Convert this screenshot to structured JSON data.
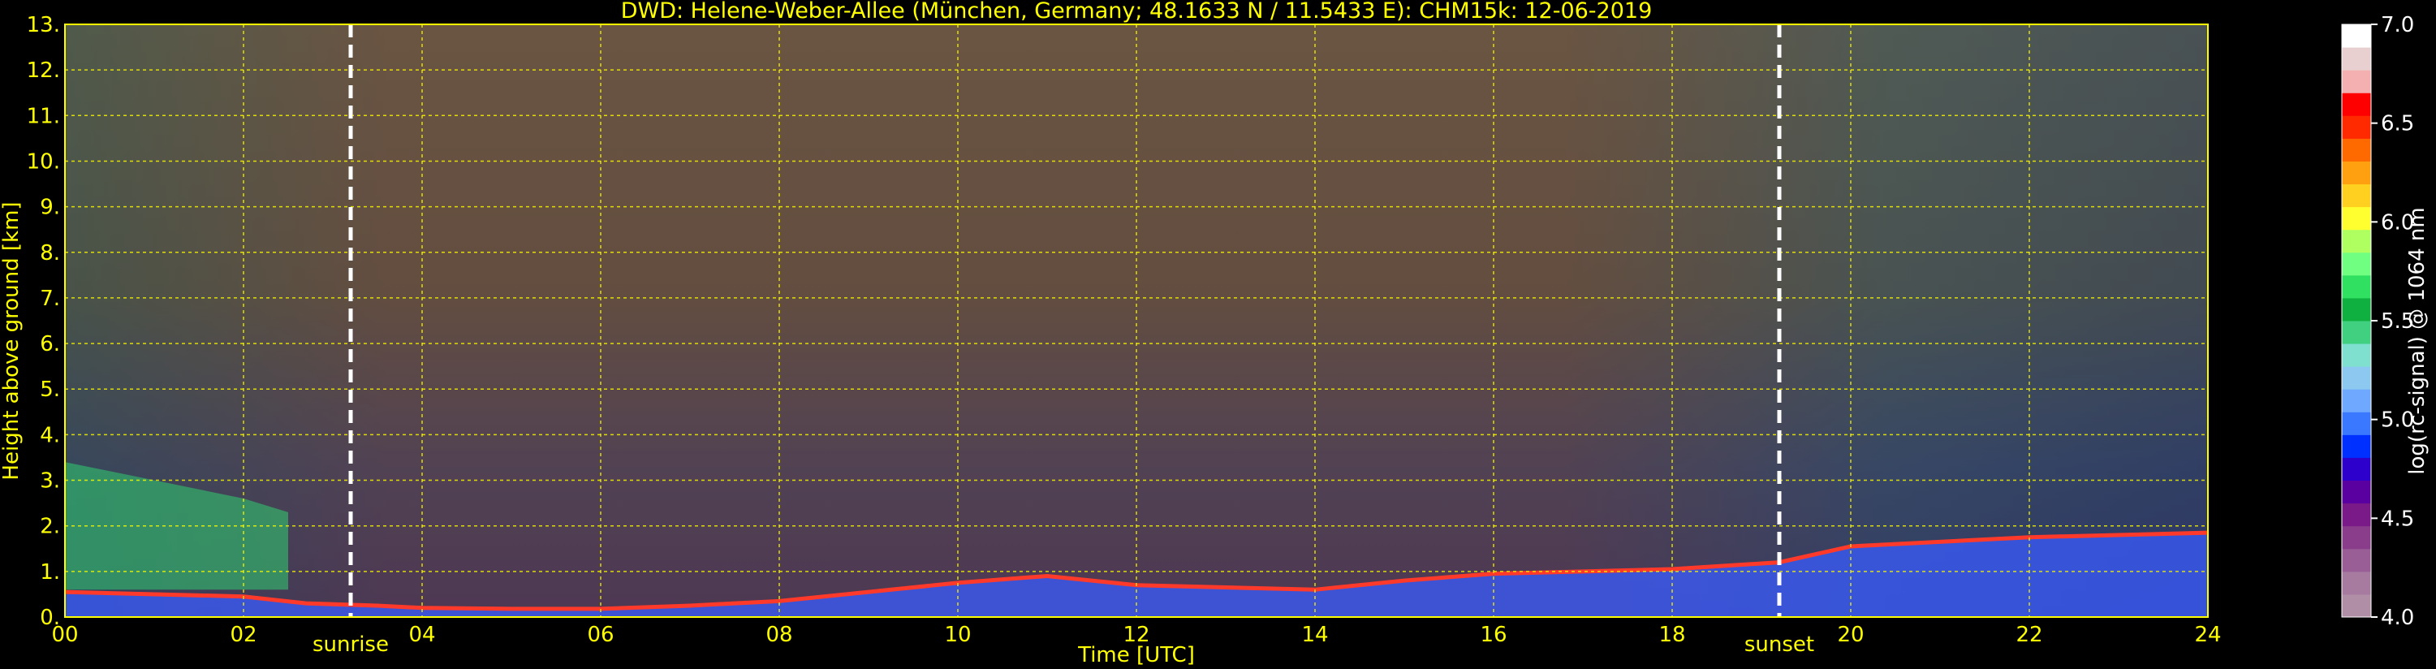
{
  "chart_data": {
    "type": "heatmap",
    "title": "DWD: Helene-Weber-Allee (München, Germany; 48.1633 N / 11.5433 E):    CHM15k: 12-06-2019",
    "xlabel": "Time [UTC]",
    "ylabel": "Height above ground [km]",
    "xlim": [
      0,
      24
    ],
    "ylim": [
      0,
      13
    ],
    "x_ticks": [
      "00",
      "02",
      "04",
      "06",
      "08",
      "10",
      "12",
      "14",
      "16",
      "18",
      "20",
      "22",
      "24"
    ],
    "x_tick_values": [
      0,
      2,
      4,
      6,
      8,
      10,
      12,
      14,
      16,
      18,
      20,
      22,
      24
    ],
    "y_ticks": [
      "0.",
      "1.",
      "2.",
      "3.",
      "4.",
      "5.",
      "6.",
      "7.",
      "8.",
      "9.",
      "10.",
      "11.",
      "12.",
      "13."
    ],
    "y_tick_values": [
      0,
      1,
      2,
      3,
      4,
      5,
      6,
      7,
      8,
      9,
      10,
      11,
      12,
      13
    ],
    "grid": true,
    "grid_color": "#ffff00",
    "events": [
      {
        "label": "sunrise",
        "time": 3.2
      },
      {
        "label": "sunset",
        "time": 19.2
      }
    ],
    "colorbar": {
      "label": "log(rc-signal) @ 1064 nm",
      "range": [
        4.0,
        7.0
      ],
      "ticks": [
        "4.0",
        "4.5",
        "5.0",
        "5.5",
        "6.0",
        "6.5",
        "7.0"
      ],
      "tick_values": [
        4.0,
        4.5,
        5.0,
        5.5,
        6.0,
        6.5,
        7.0
      ],
      "colors": [
        "#b08ea6",
        "#a77aa0",
        "#9a5e96",
        "#8a3d8a",
        "#7a1a88",
        "#5a00a0",
        "#2d00cc",
        "#0030ff",
        "#3a78ff",
        "#6fa8ff",
        "#8cc8f0",
        "#7fe0d0",
        "#40d080",
        "#10b040",
        "#30e060",
        "#70ff80",
        "#b0ff60",
        "#ffff30",
        "#ffd020",
        "#ffa010",
        "#ff6a00",
        "#ff2a00",
        "#ff0000",
        "#f4b0b0",
        "#e8d0d0",
        "#ffffff"
      ]
    },
    "features": [
      {
        "name": "boundary layer top",
        "t": [
          0,
          2,
          2.7,
          3.5,
          4,
          5,
          6,
          7,
          7.5,
          8,
          8.5,
          9,
          10,
          11,
          12,
          13,
          14,
          15,
          16,
          17,
          18,
          19.2,
          20,
          22,
          24
        ],
        "h": [
          0.55,
          0.45,
          0.3,
          0.25,
          0.2,
          0.18,
          0.18,
          0.25,
          0.3,
          0.35,
          0.45,
          0.55,
          0.75,
          0.9,
          0.7,
          0.65,
          0.6,
          0.8,
          0.95,
          1.0,
          1.05,
          1.2,
          1.55,
          1.75,
          1.85
        ]
      },
      {
        "name": "residual layer",
        "t": [
          0,
          1,
          2,
          2.5
        ],
        "h": [
          3.4,
          3.0,
          2.6,
          2.3
        ]
      }
    ]
  }
}
